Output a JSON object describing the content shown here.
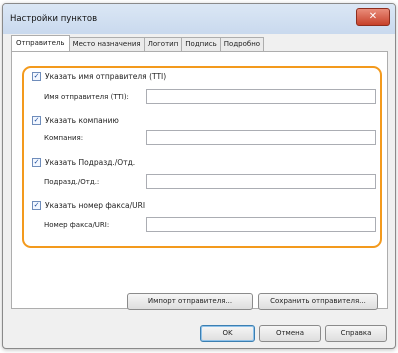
{
  "window": {
    "title": "Настройки пунктов",
    "close_glyph": "✕"
  },
  "tabs": [
    {
      "label": "Отправитель",
      "active": true
    },
    {
      "label": "Место назначения",
      "active": false
    },
    {
      "label": "Логотип",
      "active": false
    },
    {
      "label": "Подпись",
      "active": false
    },
    {
      "label": "Подробно",
      "active": false
    }
  ],
  "sender": {
    "name_checkbox_label": "Указать имя отправителя (TTI)",
    "name_field_label": "Имя отправителя (TTI):",
    "name_value": "",
    "company_checkbox_label": "Указать компанию",
    "company_field_label": "Компания:",
    "company_value": "",
    "department_checkbox_label": "Указать Подразд./Отд.",
    "department_field_label": "Подразд./Отд.:",
    "department_value": "",
    "fax_checkbox_label": "Указать номер факса/URI",
    "fax_field_label": "Номер факса/URI:",
    "fax_value": "",
    "check_glyph": "✓"
  },
  "buttons": {
    "import": "Импорт отправителя...",
    "save": "Сохранить отправителя...",
    "ok": "OK",
    "cancel": "Отмена",
    "help": "Справка"
  },
  "colors": {
    "highlight": "#f39a1d",
    "close_button": "#c7412a"
  }
}
